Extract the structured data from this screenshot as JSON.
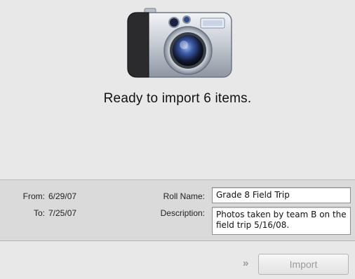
{
  "status": {
    "message": "Ready to import 6 items."
  },
  "dates": {
    "from_label": "From:",
    "from_value": "6/29/07",
    "to_label": "To:",
    "to_value": "7/25/07"
  },
  "roll": {
    "name_label": "Roll Name:",
    "name_value": "Grade 8 Field Trip",
    "description_label": "Description:",
    "description_value": "Photos taken by team B on the field trip 5/16/08."
  },
  "actions": {
    "import_label": "Import",
    "chevron_icon": "double-chevron-right-icon"
  },
  "icons": {
    "camera": "camera-icon"
  }
}
